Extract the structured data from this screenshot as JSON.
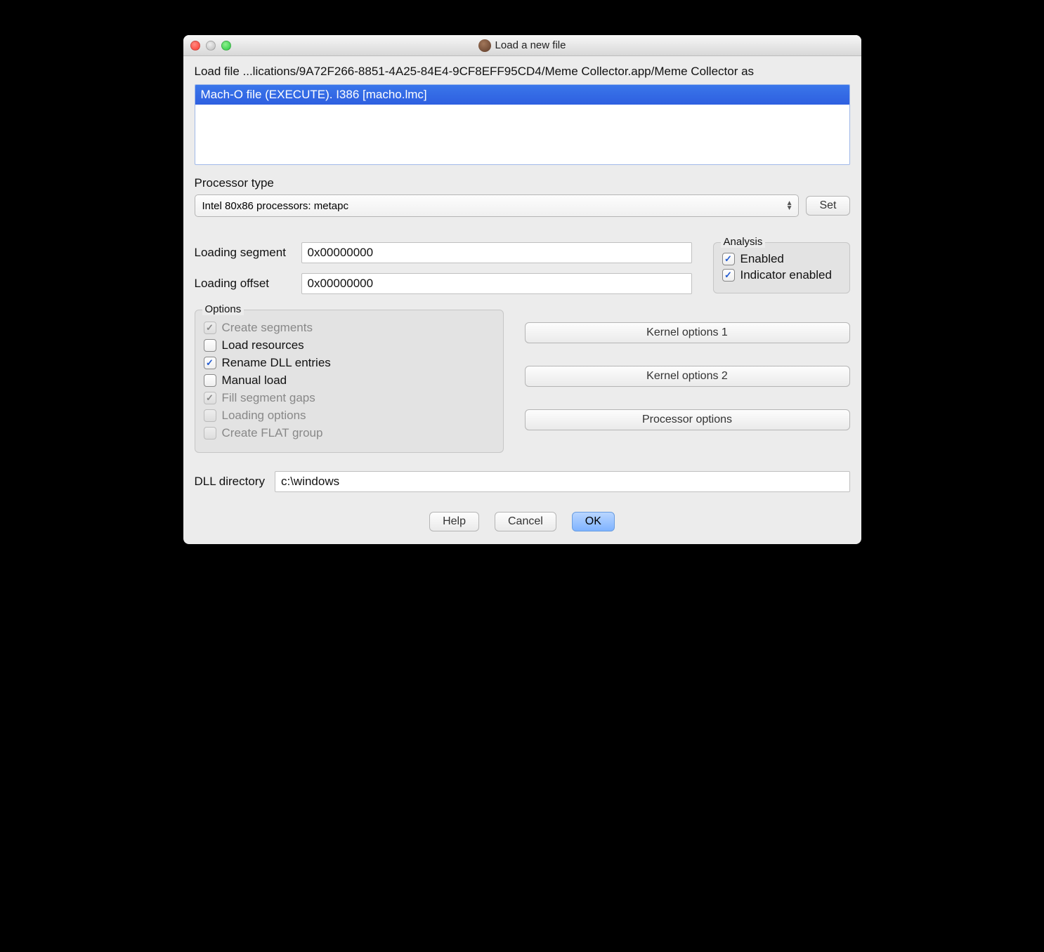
{
  "window": {
    "title": "Load a new file"
  },
  "path_line": "Load file ...lications/9A72F266-8851-4A25-84E4-9CF8EFF95CD4/Meme Collector.app/Meme Collector as",
  "file_list": {
    "item0": "Mach-O file (EXECUTE). I386 [macho.lmc]"
  },
  "processor": {
    "label": "Processor type",
    "selected": "Intel 80x86 processors: metapc",
    "set_label": "Set"
  },
  "loading": {
    "segment_label": "Loading segment",
    "segment_value": "0x00000000",
    "offset_label": "Loading offset",
    "offset_value": "0x00000000"
  },
  "analysis": {
    "legend": "Analysis",
    "enabled_label": "Enabled",
    "indicator_label": "Indicator enabled"
  },
  "options": {
    "legend": "Options",
    "create_segments": "Create segments",
    "load_resources": "Load resources",
    "rename_dll": "Rename DLL entries",
    "manual_load": "Manual load",
    "fill_gaps": "Fill segment gaps",
    "loading_options": "Loading options",
    "create_flat": "Create FLAT group"
  },
  "kernel": {
    "opt1": "Kernel options 1",
    "opt2": "Kernel options 2",
    "proc": "Processor options"
  },
  "dll": {
    "label": "DLL directory",
    "value": "c:\\windows"
  },
  "footer": {
    "help": "Help",
    "cancel": "Cancel",
    "ok": "OK"
  }
}
